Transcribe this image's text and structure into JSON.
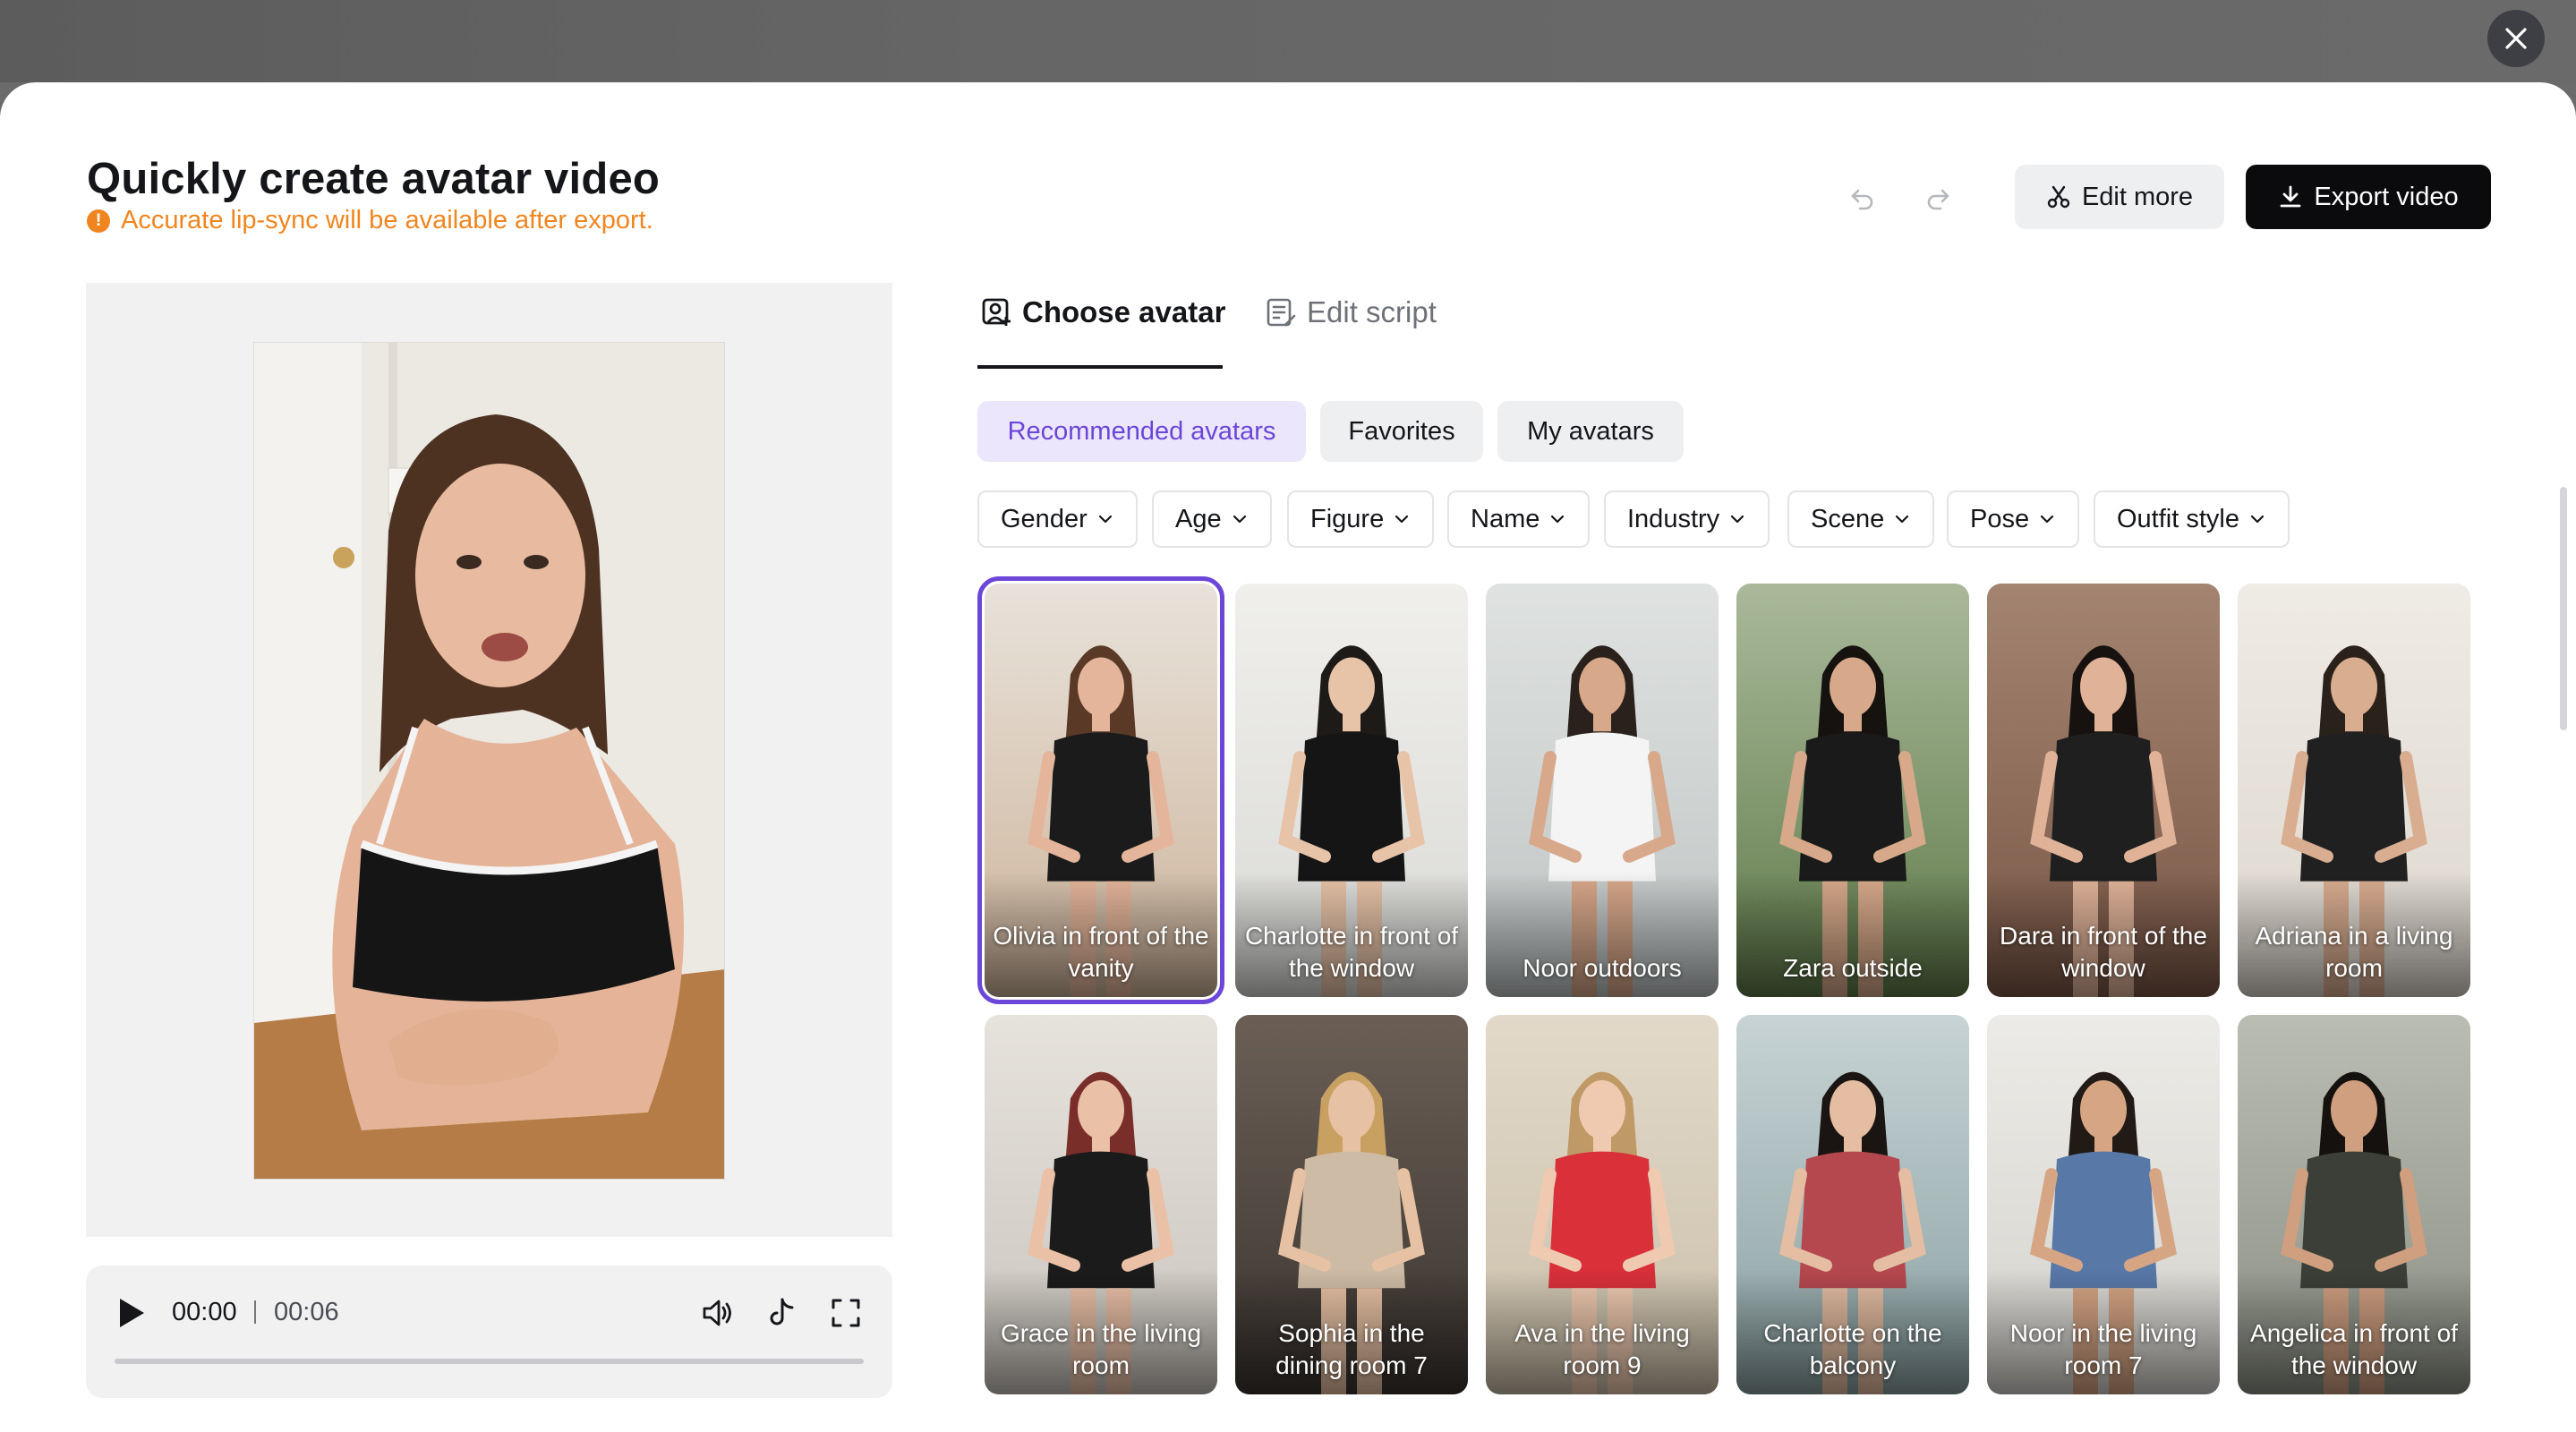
{
  "header": {
    "title": "Quickly create avatar video",
    "notice": "Accurate lip-sync will be available after export.",
    "notice_icon": "!",
    "edit_more_label": "Edit more",
    "export_label": "Export video"
  },
  "player": {
    "current_time": "00:00",
    "total_time": "00:06",
    "progress": 0.0
  },
  "tabs": [
    {
      "label": "Choose avatar",
      "active": true
    },
    {
      "label": "Edit script",
      "active": false
    }
  ],
  "categories": [
    {
      "label": "Recommended avatars",
      "active": true
    },
    {
      "label": "Favorites",
      "active": false
    },
    {
      "label": "My avatars",
      "active": false
    }
  ],
  "filters": [
    "Gender",
    "Age",
    "Figure",
    "Name",
    "Industry",
    "Scene",
    "Pose",
    "Outfit style"
  ],
  "avatars": [
    {
      "label": "Olivia in front of the vanity",
      "selected": true,
      "bg": "#cdb39a",
      "top": "#e8e2da",
      "outfit": "#1b1b1b",
      "skin": "#e4b59a",
      "hair": "#5a3a26"
    },
    {
      "label": "Charlotte in front of the window",
      "selected": false,
      "bg": "#d9d9d6",
      "top": "#f0efec",
      "outfit": "#151515",
      "skin": "#e7c3a8",
      "hair": "#1e1a17"
    },
    {
      "label": "Noor outdoors",
      "selected": false,
      "bg": "#bfc4c4",
      "top": "#dfe2e0",
      "outfit": "#f4f4f4",
      "skin": "#d8a88a",
      "hair": "#2a211c"
    },
    {
      "label": "Zara outside",
      "selected": false,
      "bg": "#5f7a49",
      "top": "#a9b99a",
      "outfit": "#1a1a1a",
      "skin": "#d7a98a",
      "hair": "#161210"
    },
    {
      "label": "Dara in front of the window",
      "selected": false,
      "bg": "#7a5747",
      "top": "#a38470",
      "outfit": "#1f1f1f",
      "skin": "#e0b399",
      "hair": "#17120f"
    },
    {
      "label": "Adriana in a living room",
      "selected": false,
      "bg": "#dcd6cd",
      "top": "#efebe5",
      "outfit": "#202020",
      "skin": "#d9ad90",
      "hair": "#2b211b"
    },
    {
      "label": "Grace in the living room",
      "selected": false,
      "bg": "#c9c4bd",
      "top": "#e6e2dc",
      "outfit": "#1b1b1b",
      "skin": "#eac0a7",
      "hair": "#7a2e2a"
    },
    {
      "label": "Sophia in the dining room 7",
      "selected": false,
      "bg": "#3a3430",
      "top": "#6b5f55",
      "outfit": "#cdbba5",
      "skin": "#e7c1a3",
      "hair": "#c8a062"
    },
    {
      "label": "Ava in the living room 9",
      "selected": false,
      "bg": "#cbbfa9",
      "top": "#e2d9ca",
      "outfit": "#d9303a",
      "skin": "#efcab0",
      "hair": "#c09a66"
    },
    {
      "label": "Charlotte on the balcony",
      "selected": false,
      "bg": "#8aa0a1",
      "top": "#c7d3d5",
      "outfit": "#b4484e",
      "skin": "#e4bda2",
      "hair": "#1a1513"
    },
    {
      "label": "Noor in the living room 7",
      "selected": false,
      "bg": "#d4d2cd",
      "top": "#ecebe7",
      "outfit": "#5878a8",
      "skin": "#d6a584",
      "hair": "#211a15"
    },
    {
      "label": "Angelica in front of the window",
      "selected": false,
      "bg": "#8a8e83",
      "top": "#b9bdb2",
      "outfit": "#3b3f37",
      "skin": "#cf9f80",
      "hair": "#15110e"
    }
  ]
}
